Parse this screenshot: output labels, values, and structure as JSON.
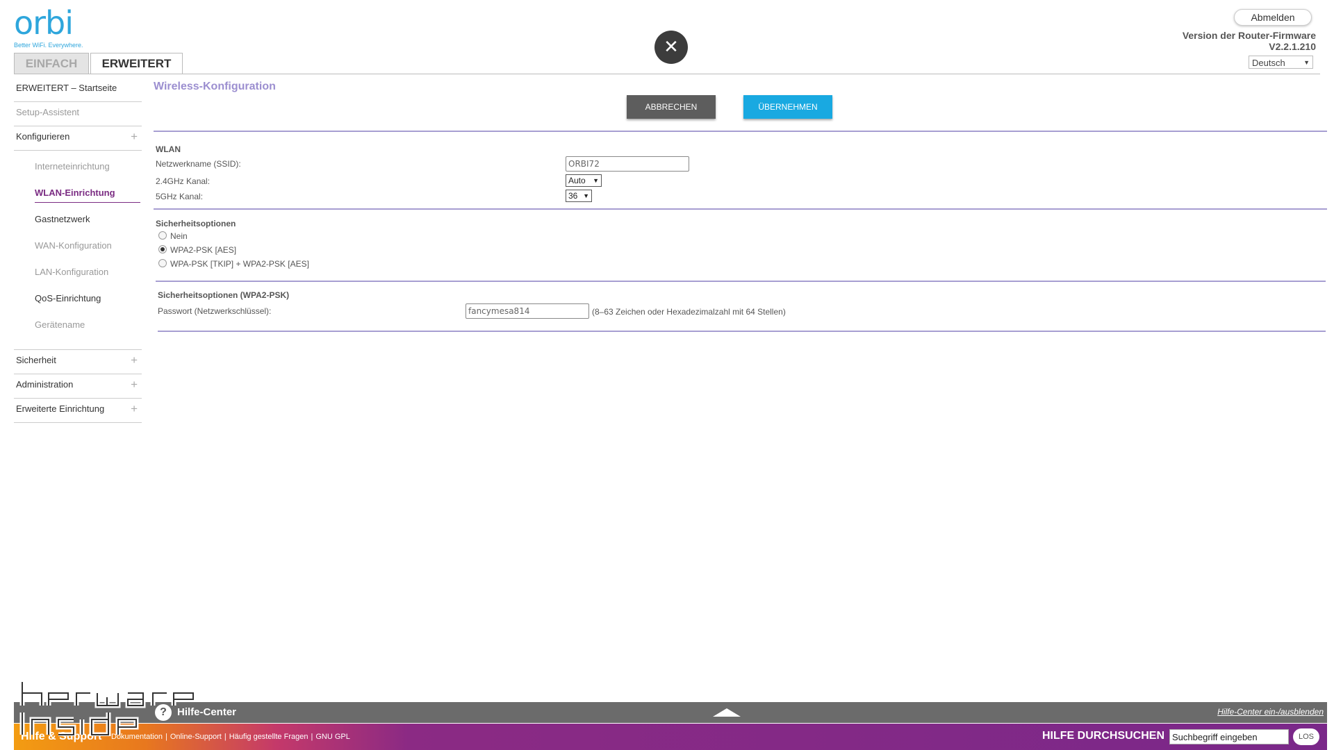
{
  "brand": {
    "logo": "orbi",
    "tagline": "Better WiFi. Everywhere.",
    "accent": "#2ea6dc"
  },
  "tabs": [
    {
      "label": "EINFACH",
      "active": false
    },
    {
      "label": "ERWEITERT",
      "active": true
    }
  ],
  "close_icon": "close-icon",
  "header": {
    "logout": "Abmelden",
    "firmware_label": "Version der Router-Firmware",
    "firmware_version": "V2.2.1.210",
    "language": "Deutsch"
  },
  "sidebar": {
    "items": [
      {
        "label": "ERWEITERT – Startseite"
      },
      {
        "label": "Setup-Assistent"
      },
      {
        "label": "Konfigurieren"
      },
      {
        "label": "Sicherheit"
      },
      {
        "label": "Administration"
      },
      {
        "label": "Erweiterte Einrichtung"
      }
    ],
    "sub": [
      {
        "label": "Interneteinrichtung"
      },
      {
        "label": "WLAN-Einrichtung"
      },
      {
        "label": "Gastnetzwerk"
      },
      {
        "label": "WAN-Konfiguration"
      },
      {
        "label": "LAN-Konfiguration"
      },
      {
        "label": "QoS-Einrichtung"
      },
      {
        "label": "Gerätename"
      }
    ],
    "expand_icon": "+"
  },
  "main": {
    "title": "Wireless-Konfiguration",
    "cancel": "ABBRECHEN",
    "apply": "ÜBERNEHMEN",
    "wlan": {
      "title": "WLAN",
      "ssid_label": "Netzwerkname (SSID):",
      "ssid_value": "ORBI72",
      "ch24_label": "2.4GHz Kanal:",
      "ch24_value": "Auto",
      "ch5_label": "5GHz Kanal:",
      "ch5_value": "36"
    },
    "security": {
      "title": "Sicherheitsoptionen",
      "options": [
        {
          "label": "Nein",
          "checked": false
        },
        {
          "label": "WPA2-PSK [AES]",
          "checked": true
        },
        {
          "label": "WPA-PSK [TKIP] + WPA2-PSK [AES]",
          "checked": false
        }
      ]
    },
    "wpa2": {
      "title": "Sicherheitsoptionen (WPA2-PSK)",
      "password_label": "Passwort (Netzwerkschlüssel):",
      "password_value": "fancymesa814",
      "hint": "(8–63 Zeichen oder Hexadezimalzahl mit 64 Stellen)"
    }
  },
  "footer": {
    "help_center": "Hilfe-Center",
    "help_toggle": "Hilfe-Center ein-/ausblenden",
    "support_title": "Hilfe & Support",
    "links": [
      "Dokumentation",
      "Online-Support",
      "Häufig gestellte Fragen",
      "GNU GPL"
    ],
    "search_label": "HILFE DURCHSUCHEN",
    "search_value": "Suchbegriff eingeben",
    "search_go": "LOS"
  },
  "colors": {
    "cancel_button": "#5d5d5d",
    "apply_button": "#19a9e1",
    "active_nav": "#7a2b82",
    "page_title": "#9c8fd0",
    "footer_purple": "#7a2889"
  }
}
